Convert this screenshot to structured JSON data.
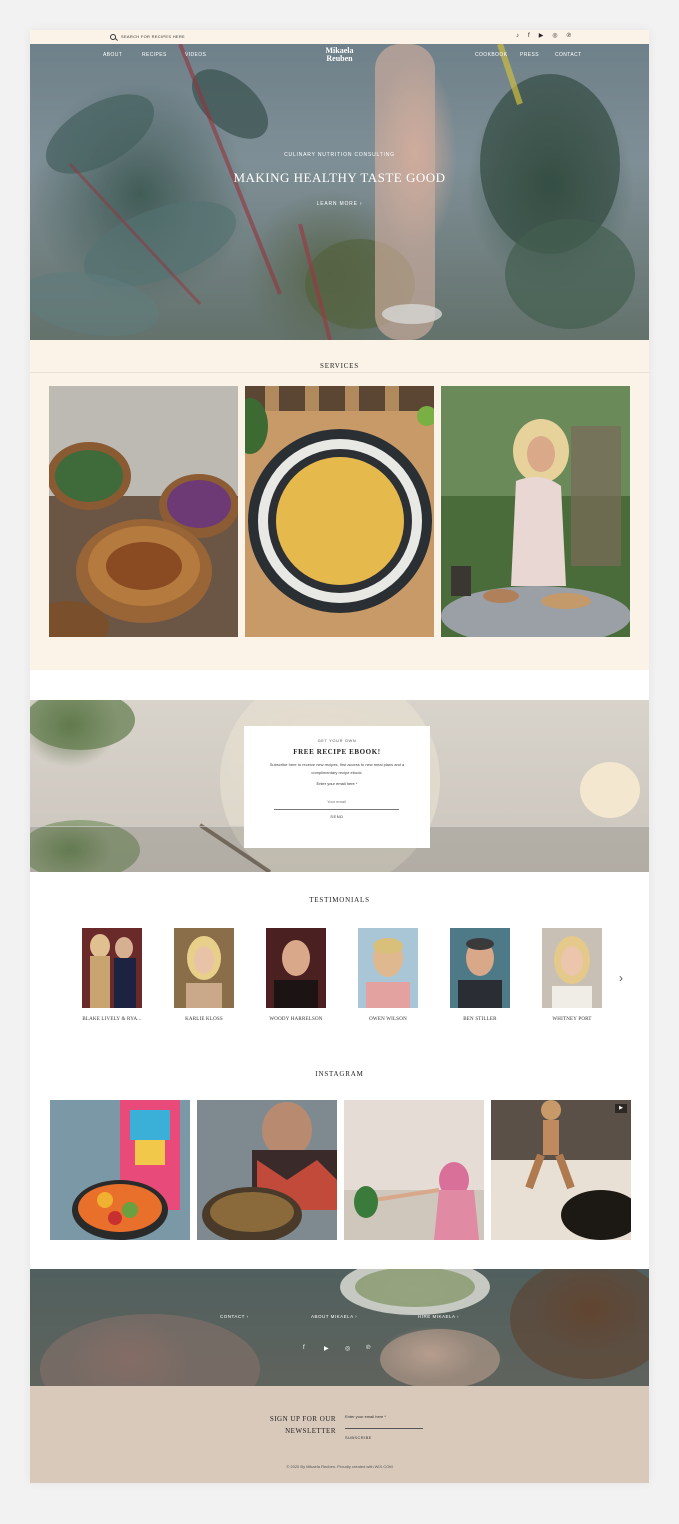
{
  "topbar": {
    "search_placeholder": "SEARCH FOR RECIPES HERE",
    "social_icons": [
      "tiktok-icon",
      "facebook-icon",
      "youtube-icon",
      "instagram-icon",
      "pinterest-icon"
    ],
    "social_glyphs": [
      "♪",
      "f",
      "▶",
      "◎",
      "℗"
    ]
  },
  "nav": {
    "left": [
      "ABOUT",
      "RECIPES",
      "VIDEOS"
    ],
    "right": [
      "COOKBOOK",
      "PRESS",
      "CONTACT"
    ],
    "logo_line1": "Mikaela",
    "logo_line2": "Reuben"
  },
  "hero": {
    "kicker": "CULINARY NUTRITION CONSULTING",
    "title": "MAKING HEALTHY TASTE GOOD",
    "cta": "LEARN MORE  ›"
  },
  "services": {
    "title": "SERVICES"
  },
  "ebook": {
    "kicker": "GET YOUR OWN",
    "title": "FREE RECIPE EBOOK!",
    "description": "Subscribe here to receive new recipes, first access to new meal plans and a complimentary recipe ebook.",
    "email_label": "Enter your email here *",
    "email_placeholder": "Your email",
    "send_label": "SEND"
  },
  "testimonials": {
    "title": "TESTIMONIALS",
    "people": [
      {
        "name": "BLAKE LIVELY & RYA..."
      },
      {
        "name": "KARLIE KLOSS"
      },
      {
        "name": "WOODY HARRELSON"
      },
      {
        "name": "OWEN WILSON"
      },
      {
        "name": "BEN STILLER"
      },
      {
        "name": "WHITNEY PORT"
      }
    ],
    "next_glyph": "›"
  },
  "instagram": {
    "title": "INSTAGRAM",
    "video_glyph": "▶"
  },
  "footer_links": {
    "contact": "CONTACT  ›",
    "about": "ABOUT MIKAELA  ›",
    "hire": "HIRE MIKAELA  ›",
    "social_glyphs": [
      "f",
      "▶",
      "◎",
      "℗"
    ]
  },
  "newsletter": {
    "heading_line1": "SIGN UP FOR OUR",
    "heading_line2": "NEWSLETTER",
    "email_label": "Enter your email here *",
    "subscribe_label": "SUBSCRIBE",
    "copyright": "© 2020 By Mikaela Reuben. Proudly created with WIX.COM"
  },
  "colors": {
    "cream": "#fbf3e8",
    "sand": "#d8c9bb",
    "text": "#2b2b2b"
  }
}
